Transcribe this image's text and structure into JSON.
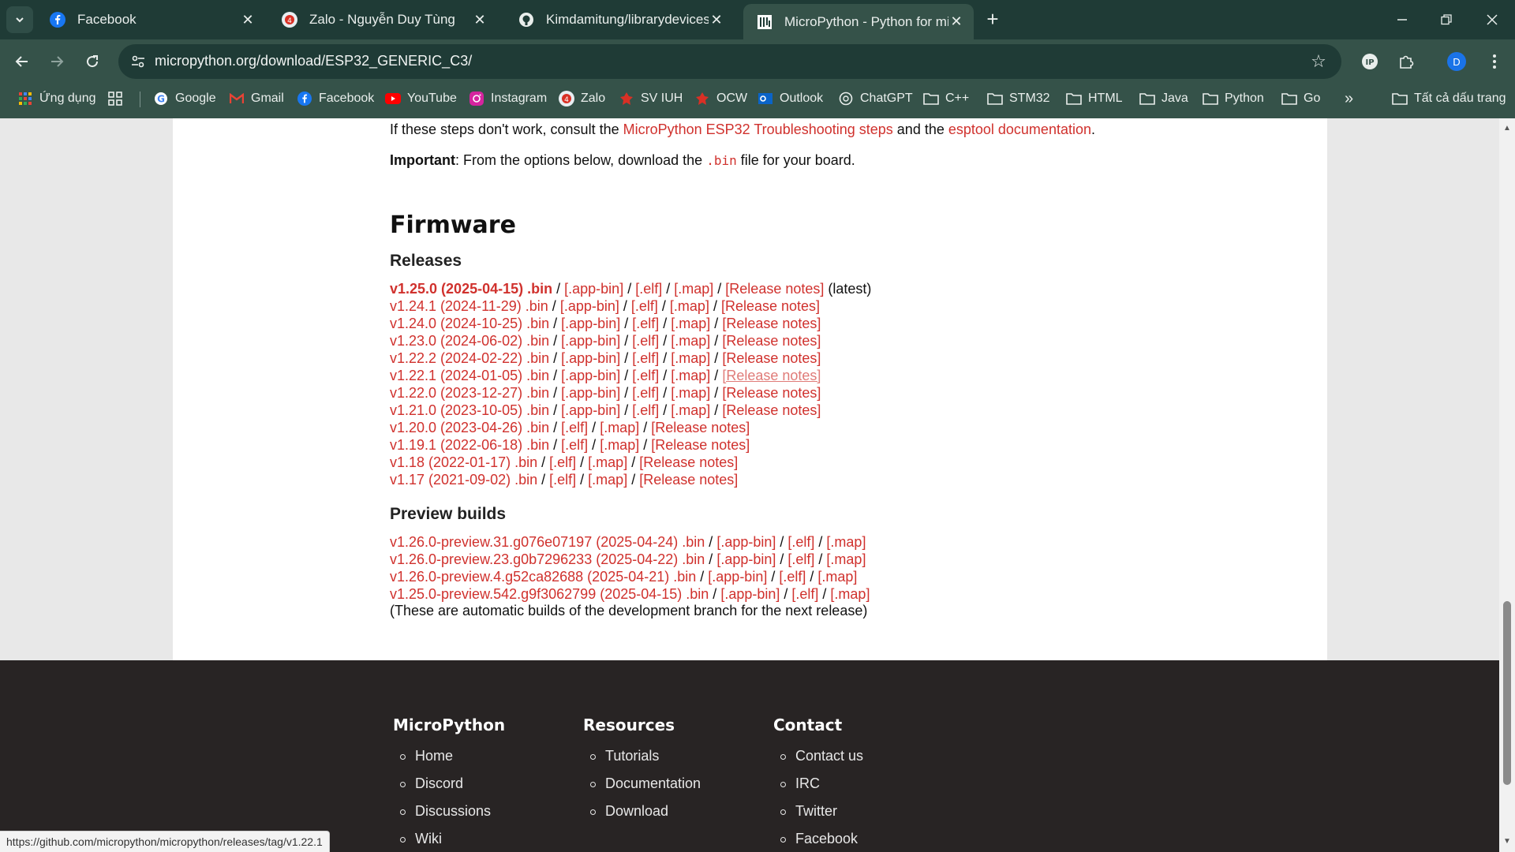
{
  "tabs": [
    {
      "title": "Facebook",
      "icon": "facebook-icon"
    },
    {
      "title": "Zalo - Nguyễn Duy Tùng",
      "icon": "zalo-icon"
    },
    {
      "title": "Kimdamitung/librarydevices",
      "icon": "github-icon"
    },
    {
      "title": "MicroPython - Python for micro",
      "icon": "micropython-icon"
    }
  ],
  "omnibox": {
    "url": "micropython.org/download/ESP32_GENERIC_C3/"
  },
  "profile": {
    "initial": "D"
  },
  "bookmarks": [
    {
      "label": "Ứng dụng",
      "icon": "apps-icon"
    },
    {
      "label": "Google",
      "icon": "google-icon"
    },
    {
      "label": "Gmail",
      "icon": "gmail-icon"
    },
    {
      "label": "Facebook",
      "icon": "facebook-icon"
    },
    {
      "label": "YouTube",
      "icon": "youtube-icon"
    },
    {
      "label": "Instagram",
      "icon": "instagram-icon"
    },
    {
      "label": "Zalo",
      "icon": "zalo-icon"
    },
    {
      "label": "SV IUH",
      "icon": "iuh-icon"
    },
    {
      "label": "OCW",
      "icon": "iuh-icon"
    },
    {
      "label": "Outlook",
      "icon": "outlook-icon"
    },
    {
      "label": "ChatGPT",
      "icon": "chatgpt-icon"
    },
    {
      "label": "C++",
      "icon": "folder-icon"
    },
    {
      "label": "STM32",
      "icon": "folder-icon"
    },
    {
      "label": "HTML",
      "icon": "folder-icon"
    },
    {
      "label": "Java",
      "icon": "folder-icon"
    },
    {
      "label": "Python",
      "icon": "folder-icon"
    },
    {
      "label": "Go",
      "icon": "folder-icon"
    },
    {
      "label": "Tất cả dấu trang",
      "icon": "folder-icon"
    }
  ],
  "intro": {
    "troubleshoot_prefix": "If these steps don't work, consult the ",
    "troubleshoot_link": "MicroPython ESP32 Troubleshooting steps",
    "troubleshoot_mid": " and the ",
    "esptool_link": "esptool documentation",
    "troubleshoot_suffix": ".",
    "important_label": "Important",
    "important_text": ": From the options below, download the ",
    "important_code": ".bin",
    "important_suffix": " file for your board."
  },
  "firmware": {
    "heading": "Firmware",
    "releases_heading": "Releases",
    "preview_heading": "Preview builds",
    "preview_note": "(These are automatic builds of the development branch for the next release)",
    "latest_tag": " (latest)",
    "labels": {
      "app_bin": "[.app-bin]",
      "elf": "[.elf]",
      "map": "[.map]",
      "notes": "[Release notes]",
      "sep": " / "
    },
    "releases": [
      {
        "ver": "v1.25.0 (2025-04-15) .bin",
        "app_bin": true,
        "latest": true
      },
      {
        "ver": "v1.24.1 (2024-11-29) .bin",
        "app_bin": true
      },
      {
        "ver": "v1.24.0 (2024-10-25) .bin",
        "app_bin": true
      },
      {
        "ver": "v1.23.0 (2024-06-02) .bin",
        "app_bin": true
      },
      {
        "ver": "v1.22.2 (2024-02-22) .bin",
        "app_bin": true
      },
      {
        "ver": "v1.22.1 (2024-01-05) .bin",
        "app_bin": true,
        "hover": true
      },
      {
        "ver": "v1.22.0 (2023-12-27) .bin",
        "app_bin": true
      },
      {
        "ver": "v1.21.0 (2023-10-05) .bin",
        "app_bin": true
      },
      {
        "ver": "v1.20.0 (2023-04-26) .bin",
        "app_bin": false
      },
      {
        "ver": "v1.19.1 (2022-06-18) .bin",
        "app_bin": false
      },
      {
        "ver": "v1.18 (2022-01-17) .bin",
        "app_bin": false
      },
      {
        "ver": "v1.17 (2021-09-02) .bin",
        "app_bin": false
      }
    ],
    "previews": [
      {
        "ver": "v1.26.0-preview.31.g076e07197 (2025-04-24) .bin"
      },
      {
        "ver": "v1.26.0-preview.23.g0b7296233 (2025-04-22) .bin"
      },
      {
        "ver": "v1.26.0-preview.4.g52ca82688 (2025-04-21) .bin"
      },
      {
        "ver": "v1.25.0-preview.542.g9f3062799 (2025-04-15) .bin"
      }
    ]
  },
  "footer": {
    "columns": [
      {
        "title": "MicroPython",
        "items": [
          "Home",
          "Discord",
          "Discussions",
          "Wiki"
        ]
      },
      {
        "title": "Resources",
        "items": [
          "Tutorials",
          "Documentation",
          "Download"
        ]
      },
      {
        "title": "Contact",
        "items": [
          "Contact us",
          "IRC",
          "Twitter",
          "Facebook"
        ]
      }
    ]
  },
  "status_url": "https://github.com/micropython/micropython/releases/tag/v1.22.1",
  "colors": {
    "link": "#d0312d",
    "chrome_dark": "#1f3b36",
    "chrome": "#355249",
    "footer": "#282424"
  }
}
